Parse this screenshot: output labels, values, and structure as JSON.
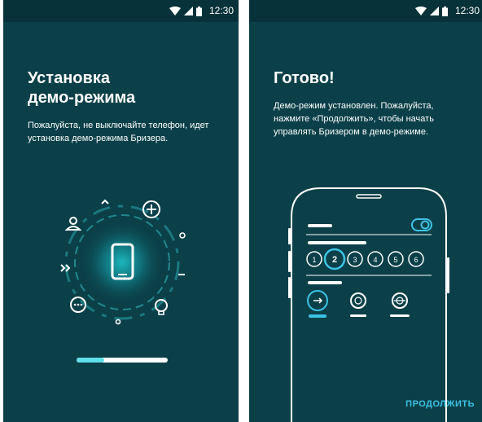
{
  "status_bar": {
    "time": "12:30"
  },
  "install_screen": {
    "title_line1": "Установка",
    "title_line2": "демо-режима",
    "description_line1": "Пожалуйста, не выключайте телефон, идет",
    "description_line2": "установка демо-режима Бризера.",
    "progress_fraction": 0.3
  },
  "done_screen": {
    "title": "Готово!",
    "description_line1": "Демо-режим установлен. Пожалуйста,",
    "description_line2": "нажмите «Продолжить», чтобы начать",
    "description_line3": "управлять Бризером в демо-режиме.",
    "speed_options": [
      "1",
      "2",
      "3",
      "4",
      "5",
      "6"
    ],
    "selected_speed": "2",
    "continue_label": "ПРОДОЛЖИТЬ"
  },
  "colors": {
    "background": "#0b4049",
    "statusbar": "#083239",
    "accent": "#3cc3e6",
    "glow": "#1aa8b0"
  }
}
